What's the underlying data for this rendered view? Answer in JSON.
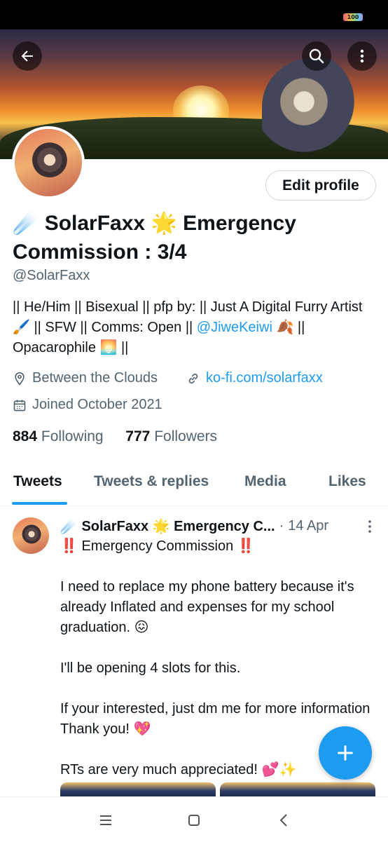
{
  "status_bar": {
    "battery": "100"
  },
  "profile": {
    "display_name_prefix": "☄️",
    "display_name_main": "SolarFaxx",
    "display_name_star": "🌟",
    "display_name_rest": "Emergency Commission : 3/4",
    "handle": "@SolarFaxx",
    "edit_button": "Edit profile",
    "bio_part1": "|| He/Him || Bisexual || pfp by: || Just A Digital Furry Artist 🖌️ || SFW || Comms: Open || ",
    "bio_mention": "@JiweKeiwi",
    "bio_part2": " 🍂 || Opacarophile 🌅 ||",
    "location": "Between the Clouds",
    "website": "ko-fi.com/solarfaxx",
    "joined": "Joined October 2021",
    "following_count": "884",
    "following_label": "Following",
    "followers_count": "777",
    "followers_label": "Followers"
  },
  "tabs": [
    {
      "label": "Tweets"
    },
    {
      "label": "Tweets & replies"
    },
    {
      "label": "Media"
    },
    {
      "label": "Likes"
    }
  ],
  "tweet": {
    "author": "☄️ SolarFaxx 🌟 Emergency C...",
    "separator": "·",
    "date": "14 Apr",
    "text": "‼️ Emergency Commission ‼️\n\nI need to replace my phone battery because it's already Inflated and  expenses for my school graduation. 😖\n\nI'll be opening 4 slots for this.\n\nIf your interested, just dm me for more information Thank you! 💖\n\nRTs are very much appreciated! 💕✨"
  },
  "icons": {
    "back": "arrow-left-icon",
    "search": "search-icon",
    "more": "more-vertical-icon",
    "location": "location-pin-icon",
    "link": "link-icon",
    "calendar": "calendar-icon",
    "compose": "plus-icon"
  },
  "colors": {
    "accent": "#1d9bf0",
    "text": "#0f1419",
    "secondary": "#536471"
  }
}
